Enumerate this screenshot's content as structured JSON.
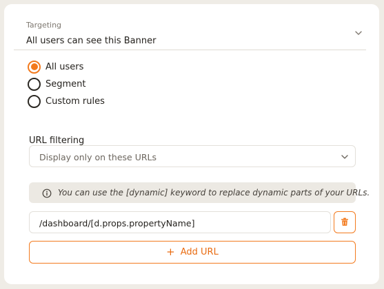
{
  "targeting": {
    "label": "Targeting",
    "value": "All users can see this Banner",
    "icon": "chevron-down-icon"
  },
  "audience": {
    "options": [
      {
        "label": "All users",
        "checked": true
      },
      {
        "label": "Segment",
        "checked": false
      },
      {
        "label": "Custom rules",
        "checked": false
      }
    ]
  },
  "url_filtering": {
    "label": "URL filtering",
    "selected": "Display only on these URLs",
    "info_text": "You can use the [dynamic] keyword to replace dynamic parts of your URLs.",
    "urls": [
      "/dashboard/[d.props.propertyName]"
    ],
    "add_label": "Add URL",
    "add_icon": "+"
  },
  "colors": {
    "accent": "#f37a1d",
    "background": "#efece6",
    "card": "#ffffff",
    "info_bg": "#ece9e3"
  }
}
